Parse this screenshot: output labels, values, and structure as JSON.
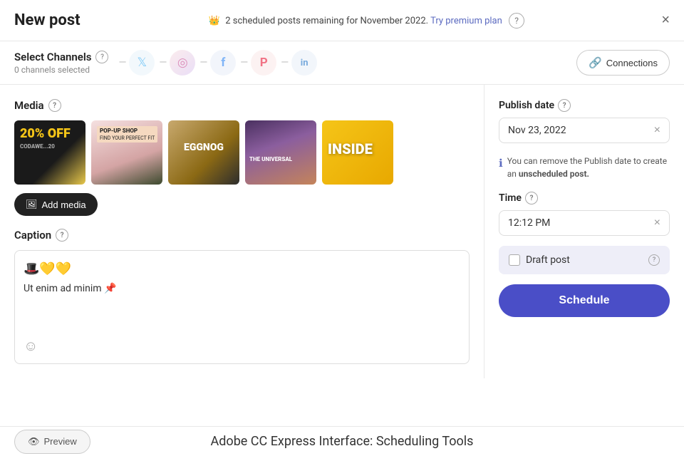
{
  "header": {
    "title": "New post",
    "notice_text": "2 scheduled posts remaining for November 2022.",
    "notice_link": "Try premium plan",
    "close_label": "×"
  },
  "channels": {
    "label": "Select Channels",
    "selected_text": "0 channels selected",
    "connections_label": "Connections",
    "items": [
      {
        "id": "twitter",
        "symbol": "𝕏"
      },
      {
        "id": "instagram",
        "symbol": "📷"
      },
      {
        "id": "facebook",
        "symbol": "f"
      },
      {
        "id": "pinterest",
        "symbol": "𝑷"
      },
      {
        "id": "linkedin",
        "symbol": "in"
      }
    ]
  },
  "media": {
    "label": "Media",
    "add_button": "Add media",
    "thumbs": [
      {
        "id": "thumb-1",
        "label": "20% Off\nCodaWe...20"
      },
      {
        "id": "thumb-2",
        "label": "POP-UP SHOP"
      },
      {
        "id": "thumb-3",
        "label": "EGGNOG"
      },
      {
        "id": "thumb-4",
        "label": "THE UNIVERSAL"
      },
      {
        "id": "thumb-5",
        "label": "INSIDE"
      }
    ]
  },
  "caption": {
    "label": "Caption",
    "emoji_line": "🎩💛💛",
    "text": "Ut enim ad minim 📌",
    "emoji_placeholder": "😊"
  },
  "publish_date": {
    "label": "Publish date",
    "value": "Nov 23, 2022",
    "info_text": "You can remove the Publish date to create an ",
    "info_bold": "unscheduled post."
  },
  "time": {
    "label": "Time",
    "value": "12:12 PM"
  },
  "draft": {
    "label": "Draft post"
  },
  "schedule_button": "Schedule",
  "preview_button": "Preview",
  "bottom_title": "Adobe CC Express Interface: Scheduling Tools"
}
